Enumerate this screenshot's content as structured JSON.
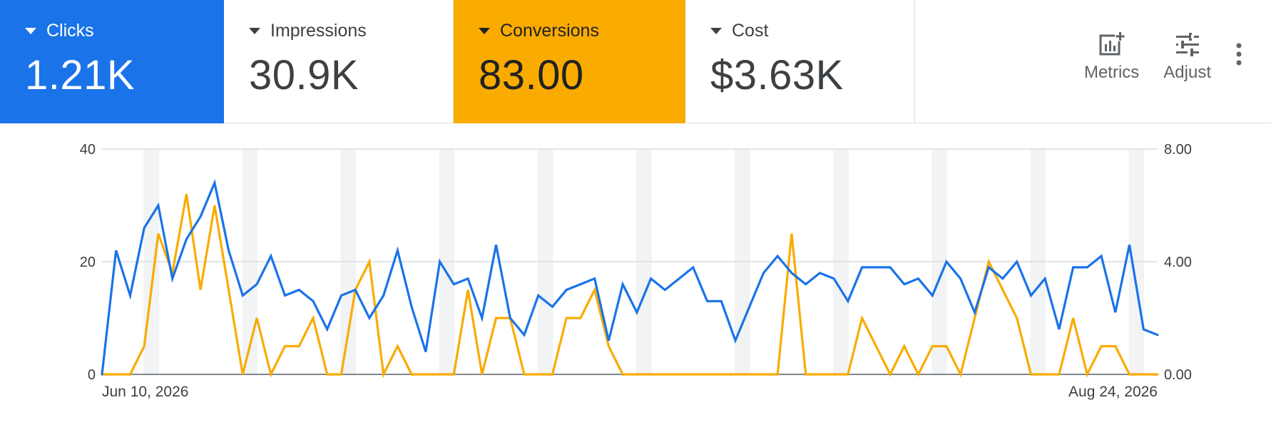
{
  "scorecards": [
    {
      "label": "Clicks",
      "value": "1.21K"
    },
    {
      "label": "Impressions",
      "value": "30.9K"
    },
    {
      "label": "Conversions",
      "value": "83.00"
    },
    {
      "label": "Cost",
      "value": "$3.63K"
    }
  ],
  "toolbar": {
    "metrics_label": "Metrics",
    "adjust_label": "Adjust"
  },
  "colors": {
    "clicks": "#1a73e8",
    "conversions": "#f9ab00",
    "weekend_band": "#f1f3f4",
    "gridline": "#dadce0"
  },
  "chart_data": {
    "type": "line",
    "x_start_label": "Jun 10, 2026",
    "x_end_label": "Aug 24, 2026",
    "y_left": {
      "range": [
        0,
        40
      ],
      "ticks": [
        "0",
        "20",
        "40"
      ]
    },
    "y_right": {
      "range": [
        0,
        8
      ],
      "ticks": [
        "0.00",
        "4.00",
        "8.00"
      ]
    },
    "grid": true,
    "weekend_bands": true,
    "series": [
      {
        "name": "Clicks",
        "axis": "left",
        "values": [
          0,
          22,
          14,
          26,
          30,
          17,
          24,
          28,
          34,
          22,
          14,
          16,
          21,
          14,
          15,
          13,
          8,
          14,
          15,
          10,
          14,
          22,
          12,
          4,
          20,
          16,
          17,
          10,
          23,
          10,
          7,
          14,
          12,
          15,
          16,
          17,
          6,
          16,
          11,
          17,
          15,
          17,
          19,
          13,
          13,
          6,
          12,
          18,
          21,
          18,
          16,
          18,
          17,
          13,
          19,
          19,
          19,
          16,
          17,
          14,
          20,
          17,
          11,
          19,
          17,
          20,
          14,
          17,
          8,
          19,
          19,
          21,
          11,
          23,
          8,
          7
        ]
      },
      {
        "name": "Conversions",
        "axis": "right",
        "values": [
          0,
          0,
          0,
          1,
          5,
          3.6,
          6.4,
          3,
          6,
          3,
          0,
          2,
          0,
          1,
          1,
          2,
          0,
          0,
          3,
          4,
          0,
          1,
          0,
          0,
          0,
          0,
          3,
          0,
          2,
          2,
          0,
          0,
          0,
          2,
          2,
          3,
          1,
          0,
          0,
          0,
          0,
          0,
          0,
          0,
          0,
          0,
          0,
          0,
          0,
          5,
          0,
          0,
          0,
          0,
          2,
          1,
          0,
          1,
          0,
          1,
          1,
          0,
          2,
          4,
          3,
          2,
          0,
          0,
          0,
          2,
          0,
          1,
          1,
          0,
          0,
          0
        ]
      }
    ]
  }
}
